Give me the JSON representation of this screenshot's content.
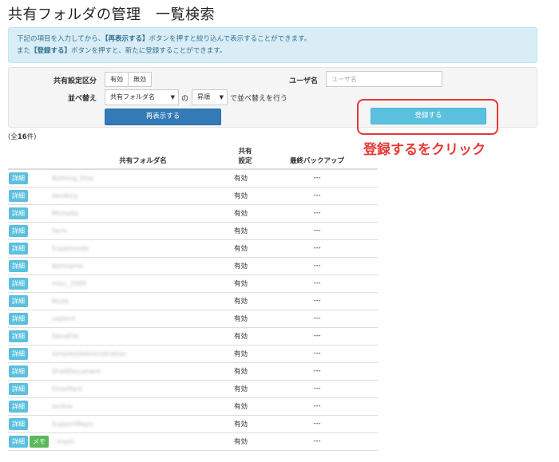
{
  "page": {
    "title": "共有フォルダの管理　一覧検索"
  },
  "info": {
    "line1_pre": "下記の項目を入力してから、",
    "line1_bold": "【再表示する】",
    "line1_post": "ボタンを押すと絞り込んで表示することができます。",
    "line2_pre": "また",
    "line2_bold": "【登録する】",
    "line2_post": "ボタンを押すと、新たに登録することができます。"
  },
  "filters": {
    "share_label": "共有設定区分",
    "share_options": [
      "有効",
      "無効"
    ],
    "user_label": "ユーザ名",
    "user_placeholder": "ユーザ名",
    "sort_label": "並べ替え",
    "sort_field": "共有フォルダ名",
    "sort_of": "の",
    "sort_order": "昇順",
    "sort_suffix": "で並べ替えを行う",
    "redisplay_label": "再表示する",
    "register_label": "登録する"
  },
  "annotation": {
    "text": "登録するをクリック",
    "color": "#e53935"
  },
  "count": {
    "prefix": "(全",
    "number": "16",
    "suffix": "件)"
  },
  "table": {
    "headers": {
      "name": "共有フォルダ名",
      "setting": "共有\n設定",
      "backup": "最終バックアップ"
    },
    "detail_label": "詳細",
    "memo_label": "メモ",
    "rows": [
      {
        "name": "Nothing_Else",
        "setting": "有効",
        "backup": "---",
        "memo": false
      },
      {
        "name": "devAmy",
        "setting": "有効",
        "backup": "---",
        "memo": false
      },
      {
        "name": "Michelle",
        "setting": "有効",
        "backup": "---",
        "memo": false
      },
      {
        "name": "farm",
        "setting": "有効",
        "backup": "---",
        "memo": false
      },
      {
        "name": "Supermode",
        "setting": "有効",
        "backup": "---",
        "memo": false
      },
      {
        "name": "Nonname",
        "setting": "有効",
        "backup": "---",
        "memo": false
      },
      {
        "name": "misc_2000",
        "setting": "有効",
        "backup": "---",
        "memo": false
      },
      {
        "name": "Node",
        "setting": "有効",
        "backup": "---",
        "memo": false
      },
      {
        "name": "sapient",
        "setting": "有効",
        "backup": "---",
        "memo": false
      },
      {
        "name": "SendFile",
        "setting": "有効",
        "backup": "---",
        "memo": false
      },
      {
        "name": "SimplestAdministration",
        "setting": "有効",
        "backup": "---",
        "memo": false
      },
      {
        "name": "ShellDocument",
        "setting": "有効",
        "backup": "---",
        "memo": false
      },
      {
        "name": "Emailfant",
        "setting": "有効",
        "backup": "---",
        "memo": false
      },
      {
        "name": "lentire",
        "setting": "有効",
        "backup": "---",
        "memo": false
      },
      {
        "name": "SupportRepo",
        "setting": "有効",
        "backup": "---",
        "memo": false
      },
      {
        "name": "mash",
        "setting": "有効",
        "backup": "---",
        "memo": true
      }
    ]
  }
}
